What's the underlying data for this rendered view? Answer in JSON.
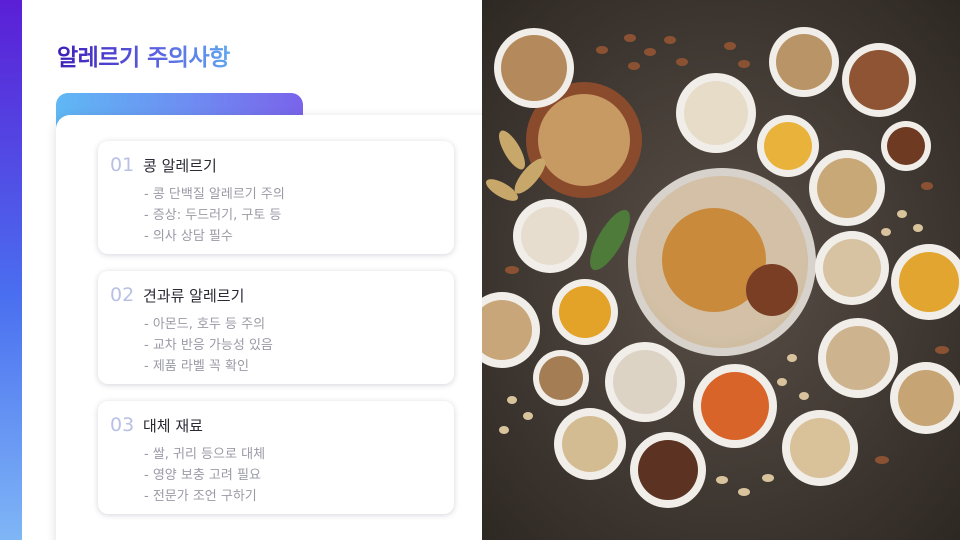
{
  "slide": {
    "title": "알레르기 주의사항"
  },
  "items": [
    {
      "number": "01",
      "heading": "콩 알레르기",
      "lines": [
        "- 콩 단백질 알레르기 주의",
        "- 증상: 두드러기, 구토 등",
        "- 의사 상담 필수"
      ]
    },
    {
      "number": "02",
      "heading": "견과류 알레르기",
      "lines": [
        "- 아몬드, 호두 등 주의",
        "- 교차 반응 가능성 있음",
        "- 제품 라벨 꼭 확인"
      ]
    },
    {
      "number": "03",
      "heading": "대체 재료",
      "lines": [
        "- 쌀, 귀리 등으로 대체",
        "- 영양 보충 고려 필요",
        "- 전문가 조언 구하기"
      ]
    }
  ],
  "colors": {
    "title_gradient_start": "#3f1fb8",
    "title_gradient_end": "#62a6f0",
    "number": "#b9c0e6",
    "photo_background": "#3b342e"
  }
}
